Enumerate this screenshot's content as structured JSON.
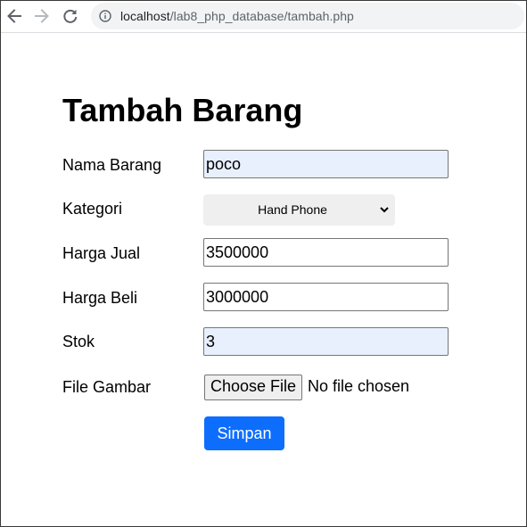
{
  "browser": {
    "url_host": "localhost",
    "url_path": "/lab8_php_database/tambah.php"
  },
  "page": {
    "title": "Tambah Barang"
  },
  "form": {
    "nama_label": "Nama Barang",
    "nama_value": "poco",
    "kategori_label": "Kategori",
    "kategori_value": "Hand Phone",
    "harga_jual_label": "Harga Jual",
    "harga_jual_value": "3500000",
    "harga_beli_label": "Harga Beli",
    "harga_beli_value": "3000000",
    "stok_label": "Stok",
    "stok_value": "3",
    "file_label": "File Gambar",
    "file_button": "Choose File",
    "file_status": "No file chosen",
    "submit_label": "Simpan"
  },
  "colors": {
    "primary_button": "#0d6efd",
    "autofill_bg": "#e8f0fe"
  },
  "icons": [
    "back-arrow-icon",
    "forward-arrow-icon",
    "reload-icon",
    "info-icon",
    "chevron-down-icon"
  ]
}
